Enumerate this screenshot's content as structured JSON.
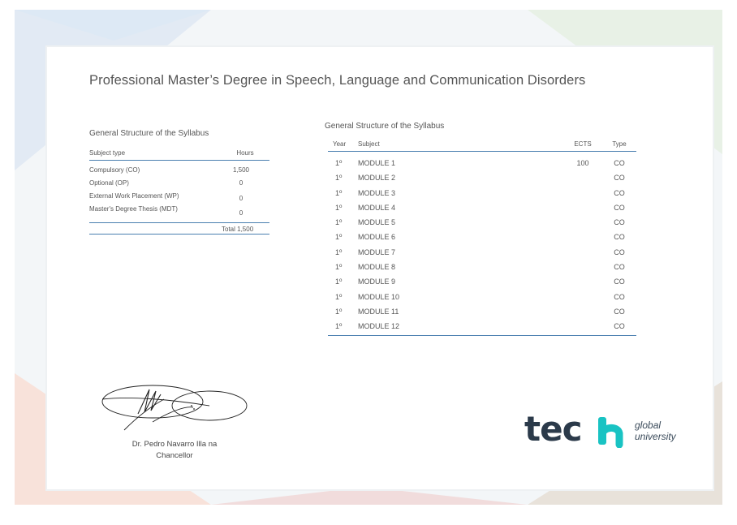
{
  "certificate": {
    "title": "Professional Master’s Degree in Speech, Language and Communication Disorders"
  },
  "summary": {
    "title": "General Structure of the Syllabus",
    "headers": {
      "subject_type": "Subject type",
      "hours": "Hours"
    },
    "rows": [
      {
        "label": "Compulsory (CO)",
        "hours": "1,500"
      },
      {
        "label": "Optional (OP)",
        "hours": "0"
      },
      {
        "label": "External Work Placement (WP)",
        "hours": "0"
      },
      {
        "label": "Master's Degree Thesis (MDT)",
        "hours": "0"
      }
    ],
    "total": "Total 1,500"
  },
  "modules": {
    "title": "General Structure of the Syllabus",
    "headers": {
      "year": "Year",
      "subject": "Subject",
      "ects": "ECTS",
      "type": "Type"
    },
    "rows": [
      {
        "year": "1º",
        "subject": "MODULE 1",
        "ects": "100",
        "type": "CO"
      },
      {
        "year": "1º",
        "subject": "MODULE 2",
        "ects": "",
        "type": "CO"
      },
      {
        "year": "1º",
        "subject": "MODULE 3",
        "ects": "",
        "type": "CO"
      },
      {
        "year": "1º",
        "subject": "MODULE 4",
        "ects": "",
        "type": "CO"
      },
      {
        "year": "1º",
        "subject": "MODULE 5",
        "ects": "",
        "type": "CO"
      },
      {
        "year": "1º",
        "subject": "MODULE 6",
        "ects": "",
        "type": "CO"
      },
      {
        "year": "1º",
        "subject": "MODULE 7",
        "ects": "",
        "type": "CO"
      },
      {
        "year": "1º",
        "subject": "MODULE 8",
        "ects": "",
        "type": "CO"
      },
      {
        "year": "1º",
        "subject": "MODULE 9",
        "ects": "",
        "type": "CO"
      },
      {
        "year": "1º",
        "subject": "MODULE 10",
        "ects": "",
        "type": "CO"
      },
      {
        "year": "1º",
        "subject": "MODULE 11",
        "ects": "",
        "type": "CO"
      },
      {
        "year": "1º",
        "subject": "MODULE 12",
        "ects": "",
        "type": "CO"
      }
    ]
  },
  "signature": {
    "name": "Dr. Pedro Navarro Illa na",
    "role": "Chancellor"
  },
  "logo": {
    "word": "tec",
    "letter": "h",
    "line1": "global",
    "line2": "university",
    "accent_color": "#19c3c3",
    "text_color": "#2b3a4a"
  },
  "colors": {
    "rule": "#4a7fb0"
  }
}
